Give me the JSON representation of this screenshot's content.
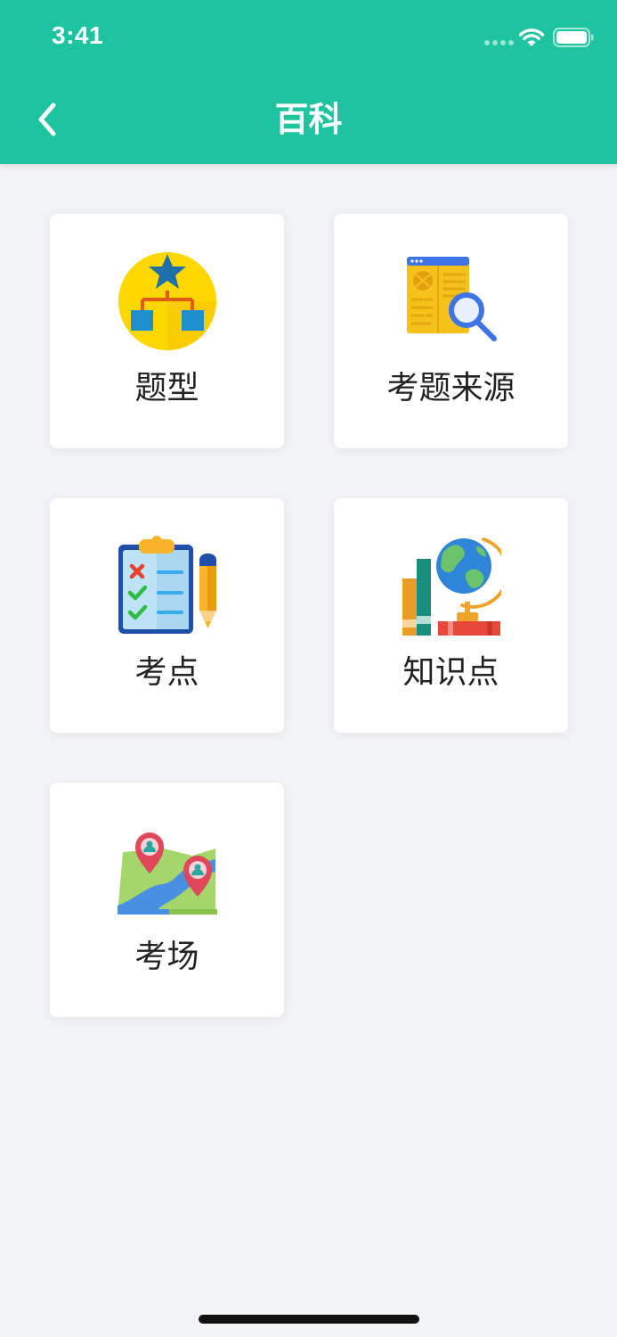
{
  "status_bar": {
    "time": "3:41"
  },
  "header": {
    "title": "百科",
    "back_icon": "chevron-left-icon"
  },
  "colors": {
    "header_bg": "#1ec49f",
    "page_bg": "#f2f3f7",
    "card_bg": "#ffffff"
  },
  "menu": [
    {
      "label": "题型",
      "icon": "hierarchy-star-icon"
    },
    {
      "label": "考题来源",
      "icon": "document-search-icon"
    },
    {
      "label": "考点",
      "icon": "checklist-clipboard-icon"
    },
    {
      "label": "知识点",
      "icon": "books-globe-icon"
    },
    {
      "label": "考场",
      "icon": "map-pins-icon"
    }
  ]
}
